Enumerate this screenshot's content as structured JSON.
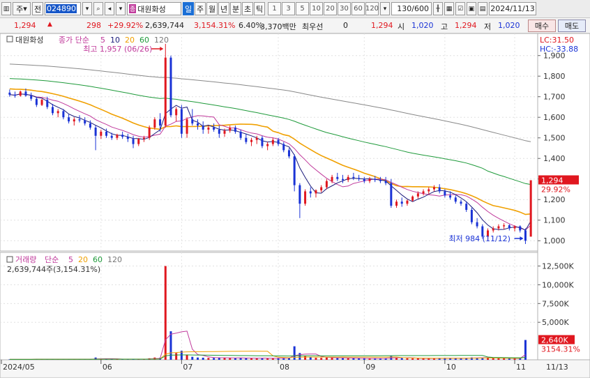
{
  "toolbar": {
    "dropdown": "주",
    "mode": "전",
    "code": "024890",
    "stock_name": "대원화성",
    "stock_badge": "종",
    "periods": [
      "일",
      "주",
      "월",
      "년",
      "분",
      "초",
      "틱"
    ],
    "active_period": "일",
    "intervals": [
      "1",
      "3",
      "5",
      "10",
      "20",
      "30",
      "60",
      "120"
    ],
    "count": "130/600",
    "date": "2024/11/13"
  },
  "quote": {
    "price": "1,294",
    "change": "298",
    "change_pct": "+29.92%",
    "volume": "2,639,744",
    "volume_ratio": "3,154.31%",
    "turnover": "6.40%",
    "amount": "3,370백만",
    "best_label": "최우선",
    "best_val": "0",
    "last": "1,294",
    "open_label": "시",
    "open": "1,020",
    "high_label": "고",
    "high": "1,294",
    "low_label": "저",
    "low": "1,020",
    "buy": "매수",
    "sell": "매도"
  },
  "price_panel": {
    "title": "대원화성",
    "ma_label": "종가 단순",
    "ma_periods": [
      "5",
      "10",
      "20",
      "60",
      "120"
    ],
    "high_note": "최고 1,957 (06/26)",
    "low_note": "최저 984 (11/12)",
    "lc": "LC:31.50",
    "hc": "HC:-33.88",
    "current_price": "1,294",
    "current_pct": "29.92%",
    "ticks": [
      "1,900",
      "1,800",
      "1,700",
      "1,600",
      "1,500",
      "1,400",
      "1,300",
      "1,200",
      "1,100",
      "1,000"
    ]
  },
  "volume_panel": {
    "title": "거래량",
    "ma_label": "단순",
    "ma_periods": [
      "5",
      "20",
      "60",
      "120"
    ],
    "current_text": "2,639,744주(3,154.31%)",
    "current_val": "2,640K",
    "current_pct": "3154.31%",
    "ticks": [
      "12,500K",
      "10,000K",
      "7,500K",
      "5,000K"
    ]
  },
  "x_axis": [
    "2024/05",
    "06",
    "07",
    "08",
    "09",
    "10",
    "11",
    "11/13"
  ],
  "colors": {
    "up": "#e0171f",
    "down": "#1a33d6",
    "ma5": "#1a1a7a",
    "ma10": "#c0399b",
    "ma20": "#f0a000",
    "ma60": "#1e9a3a",
    "ma120": "#888888"
  },
  "chart_data": {
    "type": "candlestick",
    "price_range": [
      950,
      1960
    ],
    "days": [
      [
        1720,
        1735,
        1700,
        1710
      ],
      [
        1710,
        1725,
        1695,
        1705
      ],
      [
        1705,
        1730,
        1700,
        1725
      ],
      [
        1725,
        1740,
        1700,
        1705
      ],
      [
        1705,
        1720,
        1680,
        1690
      ],
      [
        1690,
        1700,
        1650,
        1660
      ],
      [
        1660,
        1690,
        1655,
        1685
      ],
      [
        1685,
        1700,
        1640,
        1650
      ],
      [
        1650,
        1665,
        1610,
        1620
      ],
      [
        1620,
        1640,
        1600,
        1630
      ],
      [
        1630,
        1640,
        1590,
        1600
      ],
      [
        1600,
        1615,
        1570,
        1580
      ],
      [
        1580,
        1600,
        1560,
        1590
      ],
      [
        1590,
        1610,
        1575,
        1585
      ],
      [
        1585,
        1600,
        1560,
        1570
      ],
      [
        1570,
        1585,
        1540,
        1550
      ],
      [
        1550,
        1560,
        1440,
        1510
      ],
      [
        1510,
        1540,
        1495,
        1530
      ],
      [
        1530,
        1545,
        1500,
        1510
      ],
      [
        1510,
        1525,
        1490,
        1500
      ],
      [
        1500,
        1520,
        1490,
        1515
      ],
      [
        1515,
        1530,
        1495,
        1505
      ],
      [
        1505,
        1520,
        1480,
        1495
      ],
      [
        1495,
        1510,
        1450,
        1470
      ],
      [
        1470,
        1500,
        1460,
        1495
      ],
      [
        1495,
        1510,
        1480,
        1500
      ],
      [
        1500,
        1560,
        1490,
        1550
      ],
      [
        1550,
        1600,
        1540,
        1590
      ],
      [
        1590,
        1620,
        1530,
        1560
      ],
      [
        1560,
        1957,
        1550,
        1890
      ],
      [
        1890,
        1900,
        1600,
        1610
      ],
      [
        1610,
        1650,
        1580,
        1640
      ],
      [
        1640,
        1660,
        1500,
        1520
      ],
      [
        1520,
        1600,
        1500,
        1590
      ],
      [
        1590,
        1640,
        1560,
        1570
      ],
      [
        1570,
        1590,
        1540,
        1560
      ],
      [
        1560,
        1580,
        1520,
        1540
      ],
      [
        1540,
        1560,
        1520,
        1550
      ],
      [
        1550,
        1570,
        1530,
        1540
      ],
      [
        1540,
        1560,
        1500,
        1520
      ],
      [
        1520,
        1545,
        1505,
        1535
      ],
      [
        1535,
        1560,
        1525,
        1550
      ],
      [
        1550,
        1560,
        1520,
        1530
      ],
      [
        1530,
        1540,
        1490,
        1500
      ],
      [
        1500,
        1520,
        1470,
        1480
      ],
      [
        1480,
        1500,
        1460,
        1490
      ],
      [
        1490,
        1510,
        1470,
        1500
      ],
      [
        1500,
        1510,
        1450,
        1460
      ],
      [
        1460,
        1480,
        1440,
        1470
      ],
      [
        1470,
        1500,
        1460,
        1490
      ],
      [
        1490,
        1500,
        1460,
        1470
      ],
      [
        1470,
        1480,
        1430,
        1440
      ],
      [
        1440,
        1450,
        1400,
        1410
      ],
      [
        1410,
        1420,
        1240,
        1270
      ],
      [
        1270,
        1280,
        1110,
        1180
      ],
      [
        1180,
        1250,
        1170,
        1240
      ],
      [
        1240,
        1260,
        1210,
        1230
      ],
      [
        1230,
        1250,
        1210,
        1245
      ],
      [
        1245,
        1270,
        1235,
        1260
      ],
      [
        1260,
        1300,
        1250,
        1290
      ],
      [
        1290,
        1320,
        1280,
        1310
      ],
      [
        1310,
        1330,
        1290,
        1300
      ],
      [
        1300,
        1320,
        1280,
        1295
      ],
      [
        1295,
        1320,
        1285,
        1310
      ],
      [
        1310,
        1330,
        1295,
        1305
      ],
      [
        1305,
        1320,
        1290,
        1300
      ],
      [
        1300,
        1310,
        1280,
        1290
      ],
      [
        1290,
        1310,
        1280,
        1300
      ],
      [
        1300,
        1315,
        1285,
        1295
      ],
      [
        1295,
        1310,
        1280,
        1290
      ],
      [
        1290,
        1310,
        1270,
        1280
      ],
      [
        1280,
        1300,
        1160,
        1170
      ],
      [
        1170,
        1200,
        1160,
        1190
      ],
      [
        1190,
        1210,
        1165,
        1180
      ],
      [
        1180,
        1200,
        1170,
        1195
      ],
      [
        1195,
        1220,
        1190,
        1215
      ],
      [
        1215,
        1240,
        1205,
        1230
      ],
      [
        1230,
        1250,
        1220,
        1240
      ],
      [
        1240,
        1260,
        1225,
        1250
      ],
      [
        1250,
        1270,
        1240,
        1260
      ],
      [
        1260,
        1275,
        1230,
        1240
      ],
      [
        1240,
        1250,
        1210,
        1220
      ],
      [
        1220,
        1240,
        1200,
        1210
      ],
      [
        1210,
        1220,
        1180,
        1190
      ],
      [
        1190,
        1200,
        1170,
        1180
      ],
      [
        1180,
        1190,
        1140,
        1150
      ],
      [
        1150,
        1160,
        1080,
        1090
      ],
      [
        1090,
        1110,
        1060,
        1070
      ],
      [
        1070,
        1080,
        1010,
        1020
      ],
      [
        1020,
        1060,
        1000,
        1050
      ],
      [
        1050,
        1070,
        1040,
        1060
      ],
      [
        1060,
        1080,
        1050,
        1070
      ],
      [
        1070,
        1085,
        1055,
        1075
      ],
      [
        1075,
        1080,
        1050,
        1060
      ],
      [
        1060,
        1075,
        1045,
        1070
      ],
      [
        1070,
        1075,
        1040,
        1050
      ],
      [
        1050,
        1060,
        984,
        1000
      ],
      [
        1020,
        1294,
        1020,
        1294
      ]
    ],
    "volume_k": [
      60,
      50,
      55,
      70,
      60,
      80,
      50,
      60,
      90,
      70,
      60,
      80,
      70,
      60,
      75,
      90,
      300,
      120,
      90,
      80,
      70,
      85,
      90,
      110,
      80,
      70,
      200,
      300,
      260,
      12500,
      3800,
      900,
      1200,
      700,
      400,
      300,
      280,
      250,
      240,
      300,
      260,
      220,
      200,
      260,
      240,
      200,
      190,
      230,
      200,
      210,
      190,
      250,
      300,
      1800,
      900,
      500,
      350,
      260,
      250,
      300,
      280,
      230,
      220,
      200,
      210,
      190,
      180,
      170,
      160,
      190,
      210,
      500,
      260,
      220,
      200,
      180,
      190,
      170,
      180,
      200,
      220,
      230,
      200,
      190,
      210,
      240,
      320,
      280,
      300,
      250,
      220,
      200,
      180,
      170,
      160,
      240,
      2640
    ]
  }
}
